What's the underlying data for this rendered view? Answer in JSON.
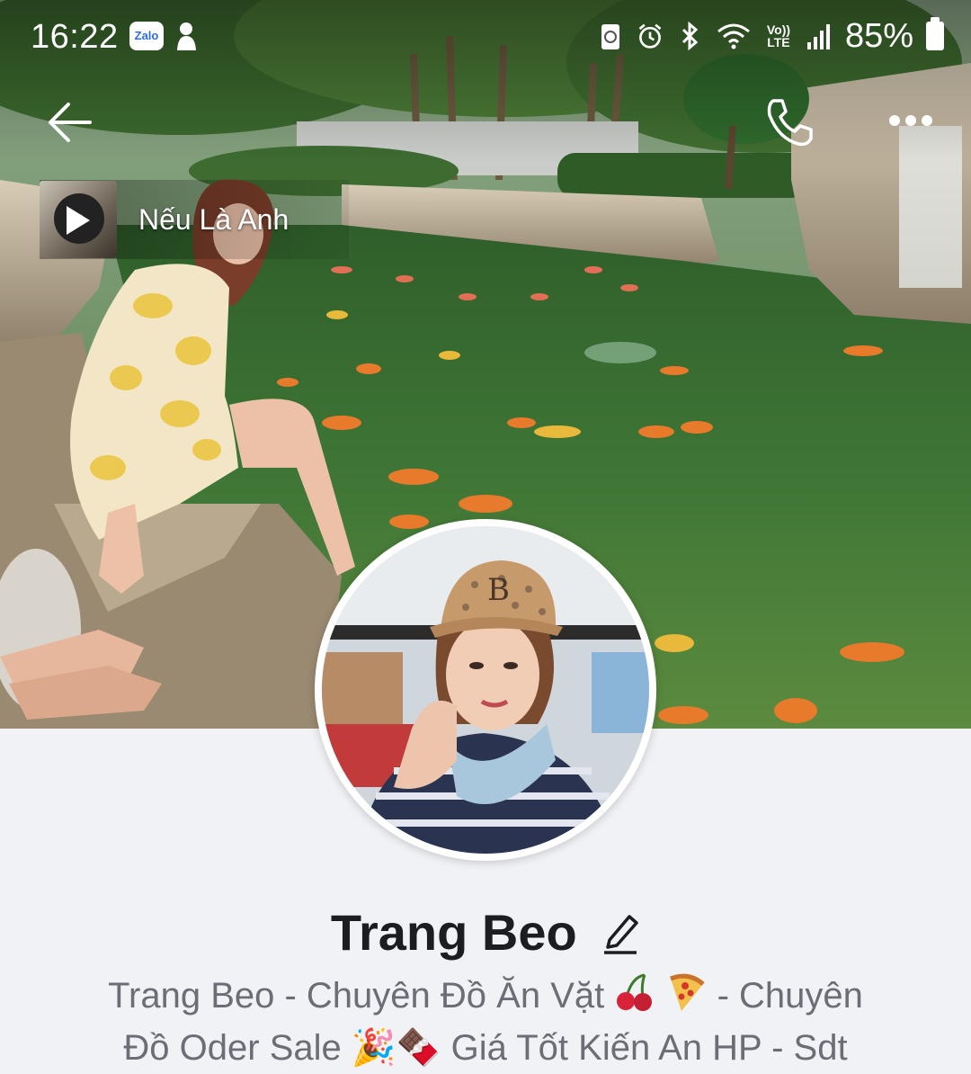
{
  "status_bar": {
    "time": "16:22",
    "app_icon": "Zalo",
    "battery_percent": "85%",
    "volte": "Vo)) LTE"
  },
  "header": {
    "back_icon": "arrow-left-icon",
    "call_icon": "phone-icon",
    "more_icon": "more-dots-icon"
  },
  "music": {
    "title": "Nếu Là Anh",
    "play_icon": "play-icon"
  },
  "profile": {
    "name": "Trang Beo",
    "edit_icon": "pencil-icon",
    "bio_line1_part1": "Trang Beo - Chuyên Đồ Ăn Vặt",
    "bio_line1_part2": "- Chuyên",
    "bio_line2": "Đồ Oder Sale 🎉🍫 Giá Tốt Kiến An HP - Sdt"
  },
  "colors": {
    "page_bg": "#f1f2f5",
    "name_text": "#1c1d21",
    "bio_text": "#6b6e76"
  }
}
